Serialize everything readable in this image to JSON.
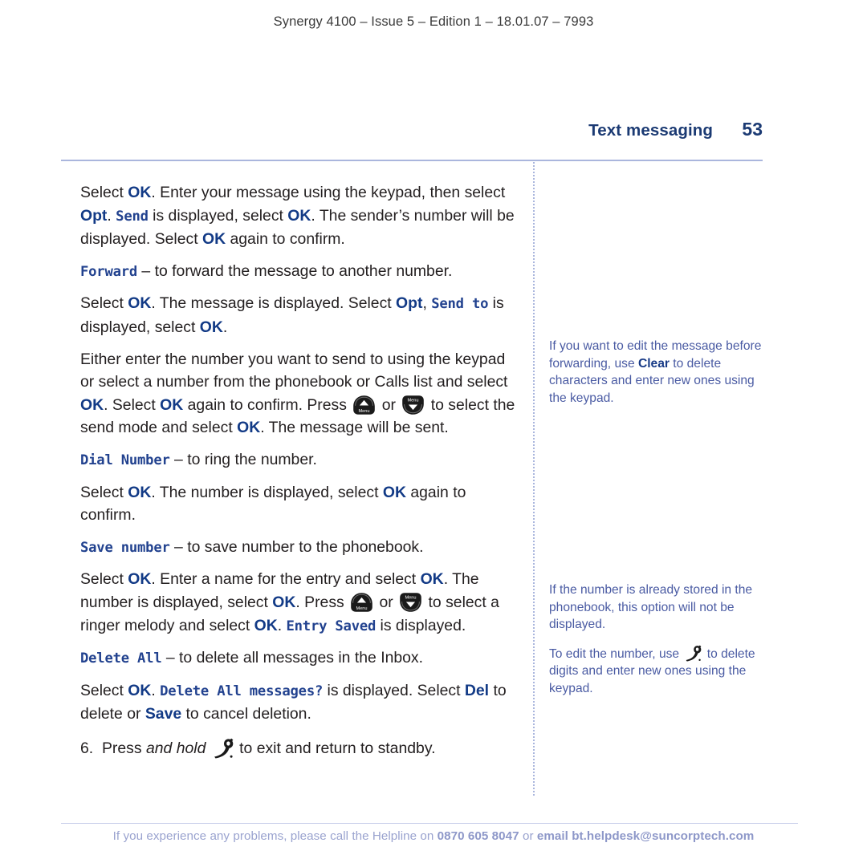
{
  "document": {
    "edition_line": "Synergy 4100 – Issue 5 – Edition 1 – 18.01.07 – 7993",
    "chapter_title": "Text messaging",
    "page_number": "53",
    "accent_color": "#1b3a73",
    "lcd_color": "#22428f",
    "note_color": "#4a5ba3",
    "rule_color": "#aab6dd",
    "footer_color": "#9aa3cf"
  },
  "main": {
    "p1": {
      "s1": "Select ",
      "ok1": "OK",
      "s2": ". Enter your message using the keypad, then select ",
      "opt": "Opt",
      "s3": ". ",
      "lcd_send": "Send",
      "s4": " is displayed, select ",
      "ok2": "OK",
      "s5": ". The sender’s number will be displayed. Select ",
      "ok3": "OK",
      "s6": " again to confirm."
    },
    "p2": {
      "lcd_forward": "Forward",
      "s1": " – to forward the message to another number."
    },
    "p3": {
      "s1": "Select ",
      "ok1": "OK",
      "s2": ". The message is displayed. Select ",
      "opt": "Opt",
      "s3": ", ",
      "lcd_sendto": "Send to",
      "s4": " is displayed, select ",
      "ok2": "OK",
      "s5": "."
    },
    "p4": {
      "s1": "Either enter the number you want to send to using the keypad or select a number from the phonebook or Calls list and select ",
      "ok1": "OK",
      "s2": ". Select ",
      "ok2": "OK",
      "s3": " again to confirm. Press ",
      "icon_up": "menu-up-key",
      "s4": " or ",
      "icon_down": "menu-down-key",
      "s5": " to select the send mode and select ",
      "ok3": "OK",
      "s6": ". The message will be sent."
    },
    "p5": {
      "lcd_dial": "Dial Number",
      "s1": " – to ring the number."
    },
    "p6": {
      "s1": "Select ",
      "ok1": "OK",
      "s2": ". The number is displayed, select ",
      "ok2": "OK",
      "s3": " again to confirm."
    },
    "p7": {
      "lcd_save": "Save number",
      "s1": " – to save number to the phonebook."
    },
    "p8": {
      "s1": "Select ",
      "ok1": "OK",
      "s2": ". Enter a name for the entry and select ",
      "ok2": "OK",
      "s3": ". The number is displayed, select ",
      "ok3": "OK",
      "s4": ". Press ",
      "icon_up": "menu-up-key",
      "s5": " or ",
      "icon_down": "menu-down-key",
      "s6": " to select a ringer melody and select ",
      "ok4": "OK",
      "s7": ". ",
      "lcd_entry_saved": "Entry Saved",
      "s8": " is displayed."
    },
    "p9": {
      "lcd_delete_all": "Delete All",
      "s1": " – to delete all messages in the Inbox."
    },
    "p10": {
      "s1": "Select ",
      "ok1": "OK",
      "s2": ". ",
      "lcd_confirm": "Delete All messages?",
      "s3": " is displayed. Select ",
      "del": "Del",
      "s4": " to delete or ",
      "save": "Save",
      "s5": " to cancel deletion."
    },
    "step6": {
      "number": "6.",
      "s1": "Press ",
      "em": "and hold",
      "s2": " ",
      "icon_hangup": "hangup-key",
      "s3": " to exit and return to standby."
    }
  },
  "sidebar": {
    "note1": {
      "s1": "If you want to edit the message before forwarding, use ",
      "bold": "Clear",
      "s2": " to delete characters and enter new ones using the keypad."
    },
    "note2": {
      "s1": "If the number is already stored in the phonebook, this option will not be displayed."
    },
    "note3": {
      "s1": "To edit the number, use ",
      "icon_hangup": "hangup-key",
      "s2": " to delete digits and enter new ones using the keypad."
    }
  },
  "footer": {
    "s1": "If you experience any problems, please call the Helpline on ",
    "phone": "0870 605 8047",
    "s2": " or ",
    "email": "email bt.helpdesk@suncorptech.com"
  }
}
